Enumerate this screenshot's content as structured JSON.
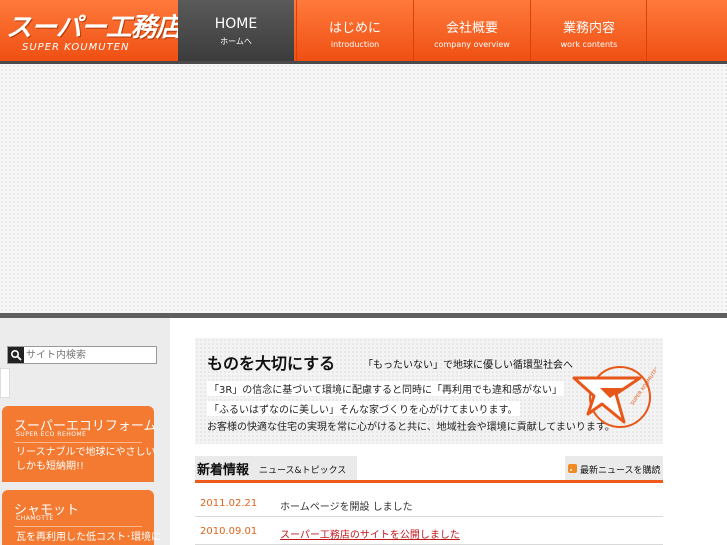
{
  "header": {
    "logo_main": "スーパー工務店",
    "logo_sub": "SUPER KOUMUTEN",
    "nav": [
      {
        "label": "HOME",
        "sub": "ホームへ"
      },
      {
        "label": "はじめに",
        "sub": "introduction"
      },
      {
        "label": "会社概要",
        "sub": "company overview"
      },
      {
        "label": "業務内容",
        "sub": "work contents"
      }
    ]
  },
  "search": {
    "value": "",
    "placeholder": "サイト内検索"
  },
  "promos": [
    {
      "title": "スーパーエコリフォーム",
      "sub": "SUPER ECO REHOME",
      "body1": "リースナブルで地球にやさしい",
      "body2": "しかも短納期!!"
    },
    {
      "title": "シャモット",
      "sub": "CHAMOTTE",
      "body1": "瓦を再利用した低コスト･環境に",
      "body2": ""
    }
  ],
  "banner": {
    "title": "ものを大切にする",
    "title_sub": "「もったいない」で地球に優しい循環型社会へ",
    "line1": "「3R」の信念に基づいて環境に配慮すると同時に「再利用でも違和感がない」",
    "line2": "「ふるいはずなのに美しい」そんな家づくりを心がけてまいります。",
    "line3": "お客様の快適な住宅の実現を常に心がけると共に、地域社会や環境に貢献してまいります。",
    "logo_text": "SUPER KOUMUTEN"
  },
  "news": {
    "title": "新着情報",
    "title_sub": "ニュース&トピックス",
    "rss_label": "最新ニュースを購読",
    "items": [
      {
        "date": "2011.02.21",
        "text": "ホームページを開設 しました"
      },
      {
        "date": "2010.09.01",
        "text": "スーパー工務店のサイトを公開しました"
      }
    ]
  },
  "colors": {
    "brand_orange": "#ef5a1a",
    "nav_active": "#4a4a4a",
    "news_date": "#e0631e",
    "link_red": "#c0171b"
  }
}
